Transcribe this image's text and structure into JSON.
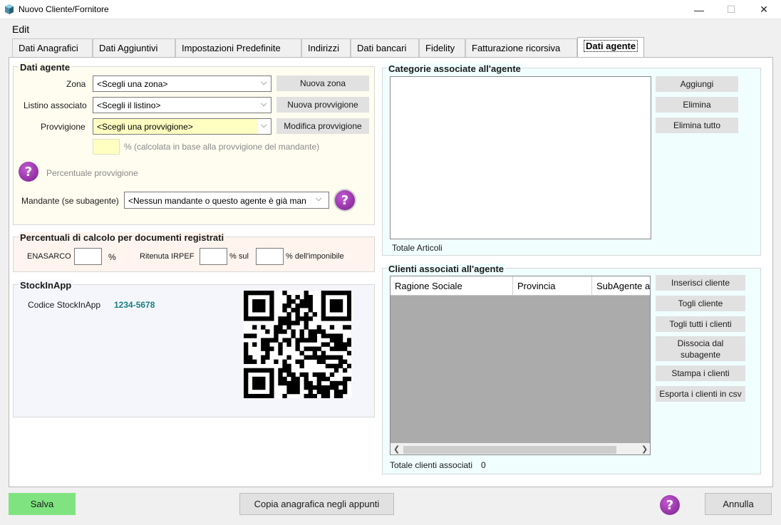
{
  "window": {
    "title": "Nuovo Cliente/Fornitore",
    "minimize": "—",
    "maximize": "☐",
    "close": "✕"
  },
  "menu": {
    "edit": "Edit"
  },
  "tabs": [
    {
      "label": "Dati Anagrafici"
    },
    {
      "label": "Dati Aggiuntivi"
    },
    {
      "label": "Impostazioni Predefinite"
    },
    {
      "label": "Indirizzi"
    },
    {
      "label": "Dati bancari"
    },
    {
      "label": "Fidelity"
    },
    {
      "label": "Fatturazione ricorsiva"
    },
    {
      "label": "Dati agente"
    }
  ],
  "dati_agente": {
    "title": "Dati agente",
    "zona_label": "Zona",
    "zona_value": "<Scegli una zona>",
    "nuova_zona": "Nuova zona",
    "listino_label": "Listino associato",
    "listino_value": "<Scegli il listino>",
    "nuova_provvigione": "Nuova provvigione",
    "provvigione_label": "Provvigione",
    "provvigione_value": "<Scegli una provvigione>",
    "modifica_provvigione": "Modifica provvigione",
    "percent_note": "% (calcolata in base alla provvigione del mandante)",
    "percentuale_provvigione": "Percentuale provvigione",
    "mandante_label": "Mandante (se subagente)",
    "mandante_value": "<Nessun mandante o questo agente è già man"
  },
  "percentuali": {
    "title": "Percentuali di calcolo per documenti registrati",
    "enasarco": "ENASARCO",
    "percent1": "%",
    "ritenuta": "Ritenuta IRPEF",
    "percent_sul": "% sul",
    "percent_imponibile": "% dell'imponibile"
  },
  "stockinapp": {
    "title": "StockInApp",
    "codice_label": "Codice StockInApp",
    "codice_value": "1234-5678"
  },
  "categorie": {
    "title": "Categorie associate all'agente",
    "aggiungi": "Aggiungi",
    "elimina": "Elimina",
    "elimina_tutto": "Elimina tutto",
    "totale_articoli": "Totale Articoli"
  },
  "clienti": {
    "title": "Clienti associati all'agente",
    "columns": [
      "Ragione Sociale",
      "Provincia",
      "SubAgente a"
    ],
    "inserisci": "Inserisci cliente",
    "togli": "Togli cliente",
    "togli_tutti": "Togli tutti i clienti",
    "dissocia_1": "Dissocia dal",
    "dissocia_2": "subagente",
    "stampa": "Stampa i clienti",
    "esporta": "Esporta i clienti in csv",
    "totale_label": "Totale clienti associati",
    "totale_value": "0"
  },
  "footer": {
    "salva": "Salva",
    "copia": "Copia anagrafica negli appunti",
    "annulla": "Annulla"
  },
  "colors": {
    "salva_bg": "#7fe47f",
    "help_purple": "#8e24aa",
    "codice_teal": "#1a7f7f",
    "dati_agente_bg": "#fffdf0",
    "percentuali_bg": "#fff4ee",
    "stockinapp_bg": "#f4f6fc",
    "right_panel_bg": "#f0fefe"
  }
}
